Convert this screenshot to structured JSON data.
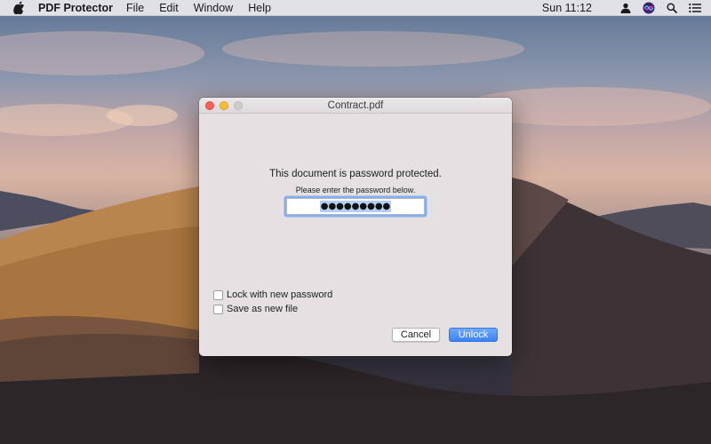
{
  "menubar": {
    "app_name": "PDF Protector",
    "menus": [
      "File",
      "Edit",
      "Window",
      "Help"
    ],
    "clock": "Sun 11:12",
    "status_icons": [
      "user-icon",
      "siri-icon",
      "spotlight-search-icon",
      "notification-center-icon"
    ]
  },
  "dialog": {
    "title": "Contract.pdf",
    "message": "This document is password protected.",
    "instruction": "Please enter the password below.",
    "password_value": "●●●●●●●●●",
    "options": [
      {
        "label": "Lock with new password",
        "checked": false
      },
      {
        "label": "Save as new file",
        "checked": false
      }
    ],
    "cancel_label": "Cancel",
    "unlock_label": "Unlock"
  },
  "colors": {
    "accent": "#3b82f5",
    "focus_ring": "#86aef2",
    "close": "#fc5f57",
    "minimize": "#fdbc2e"
  }
}
